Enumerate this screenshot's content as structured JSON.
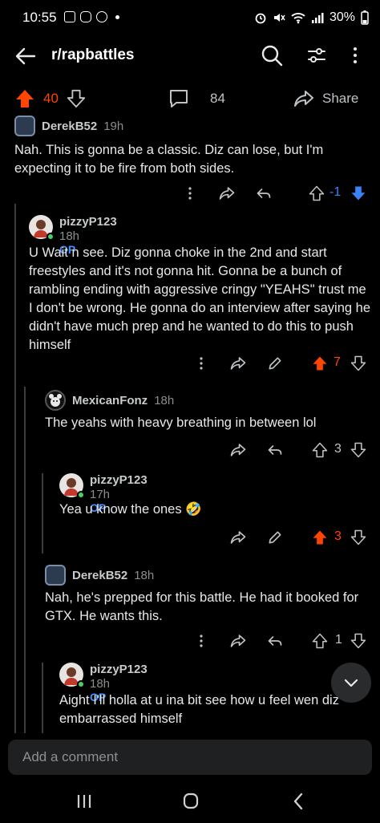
{
  "status": {
    "time": "10:55",
    "battery": "30%"
  },
  "header": {
    "title": "r/rapbattles"
  },
  "post_actions": {
    "vote_count": "40",
    "comment_count": "84",
    "share_label": "Share"
  },
  "comments": [
    {
      "user": "DerekB52",
      "time": "19h",
      "op": "",
      "body": "Nah. This is gonna be a classic. Diz can lose, but I'm expecting it to be fire from both sides.",
      "votes": "-1"
    },
    {
      "user": "pizzyP123",
      "time": "18h",
      "op": "OP",
      "body": "U Wait n see. Diz gonna choke in the 2nd and start freestyles and it's not gonna hit. Gonna be a bunch of rambling ending with aggressive cringy \"YEAHS\" trust me I don't be wrong. He gonna do an interview after saying he didn't have much prep and he wanted to do this to push himself",
      "votes": "7"
    },
    {
      "user": "MexicanFonz",
      "time": "18h",
      "op": "",
      "body": "The yeahs with heavy breathing in between lol",
      "votes": "3"
    },
    {
      "user": "pizzyP123",
      "time": "17h",
      "op": "OP",
      "body": "Yea u know the ones 🤣",
      "votes": "3"
    },
    {
      "user": "DerekB52",
      "time": "18h",
      "op": "",
      "body": "Nah, he's prepped for this battle. He had it booked for GTX. He wants this.",
      "votes": "1"
    },
    {
      "user": "pizzyP123",
      "time": "18h",
      "op": "OP",
      "body": "Aight I'll holla at u ina bit see how u feel wen diz embarrassed himself",
      "votes": ""
    }
  ],
  "composer": {
    "placeholder": "Add a comment"
  },
  "colors": {
    "upvote": "#ff4500",
    "downvote": "#3b82f6",
    "op": "#4a90ff",
    "online": "#46d160"
  }
}
